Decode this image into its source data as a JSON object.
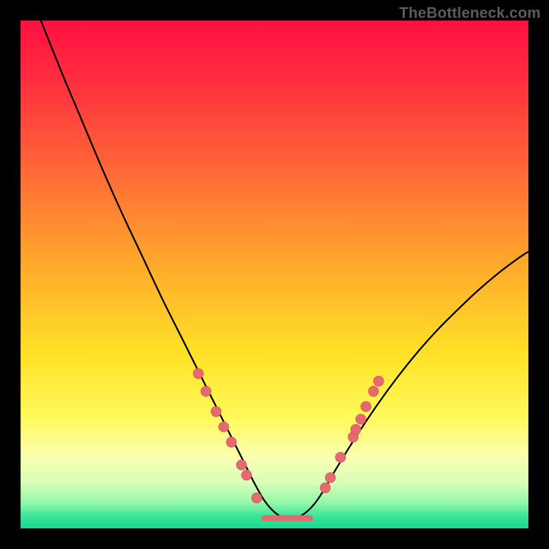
{
  "watermark": "TheBottleneck.com",
  "colors": {
    "background_frame": "#000000",
    "curve": "#000000",
    "marker_fill": "#e46a6f",
    "marker_stroke": "#c94f56",
    "gradient_stops": [
      {
        "offset": 0.0,
        "color": "#ff1040"
      },
      {
        "offset": 0.12,
        "color": "#ff2e3f"
      },
      {
        "offset": 0.3,
        "color": "#ff6a36"
      },
      {
        "offset": 0.5,
        "color": "#ffb02a"
      },
      {
        "offset": 0.66,
        "color": "#ffe228"
      },
      {
        "offset": 0.78,
        "color": "#fff95a"
      },
      {
        "offset": 0.86,
        "color": "#faffb0"
      },
      {
        "offset": 0.91,
        "color": "#d6ffb8"
      },
      {
        "offset": 0.95,
        "color": "#93f7a8"
      },
      {
        "offset": 0.975,
        "color": "#3be59a"
      },
      {
        "offset": 1.0,
        "color": "#17d98e"
      }
    ]
  },
  "chart_data": {
    "type": "line",
    "title": "",
    "xlabel": "",
    "ylabel": "",
    "xlim": [
      0,
      100
    ],
    "ylim": [
      0,
      100
    ],
    "grid": false,
    "legend": false,
    "annotations": [],
    "series": [
      {
        "name": "bottleneck-curve",
        "x": [
          0,
          4,
          8,
          12,
          16,
          20,
          24,
          28,
          32,
          34,
          36,
          38,
          40,
          42,
          44,
          46,
          48,
          50,
          52,
          54,
          56,
          58,
          60,
          62,
          66,
          70,
          74,
          78,
          82,
          86,
          90,
          94,
          98,
          100
        ],
        "y": [
          110,
          100,
          90,
          80.5,
          71,
          62,
          53.5,
          45,
          37,
          33,
          29,
          25,
          21,
          17,
          13,
          9,
          5.5,
          3.2,
          2.0,
          2.0,
          3.0,
          5.0,
          8.0,
          11.5,
          18.0,
          24.0,
          29.5,
          34.5,
          39.0,
          43.0,
          46.8,
          50.2,
          53.2,
          54.5
        ]
      }
    ],
    "flat_segment": {
      "x_start": 48,
      "x_end": 57,
      "y": 2.0,
      "thickness_px": 9
    },
    "markers": [
      {
        "x": 35.0,
        "y": 30.5
      },
      {
        "x": 36.5,
        "y": 27.0
      },
      {
        "x": 38.5,
        "y": 23.0
      },
      {
        "x": 40.0,
        "y": 20.0
      },
      {
        "x": 41.5,
        "y": 17.0
      },
      {
        "x": 43.5,
        "y": 12.5
      },
      {
        "x": 44.5,
        "y": 10.5
      },
      {
        "x": 46.5,
        "y": 6.0
      },
      {
        "x": 60.0,
        "y": 8.0
      },
      {
        "x": 61.0,
        "y": 10.0
      },
      {
        "x": 63.0,
        "y": 14.0
      },
      {
        "x": 65.5,
        "y": 18.0
      },
      {
        "x": 66.0,
        "y": 19.5
      },
      {
        "x": 67.0,
        "y": 21.5
      },
      {
        "x": 68.0,
        "y": 24.0
      },
      {
        "x": 69.5,
        "y": 27.0
      },
      {
        "x": 70.5,
        "y": 29.0
      }
    ]
  }
}
